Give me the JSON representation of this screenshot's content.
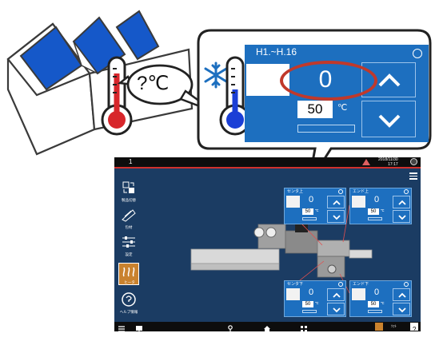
{
  "zoom": {
    "title": "H1.~H.16",
    "current_value": "0",
    "set_value": "50",
    "unit": "℃"
  },
  "thermo_bubble": {
    "text": "?℃"
  },
  "hmi": {
    "screen_no": "1",
    "date": "2018/11/30",
    "time": "17:17",
    "sidebar": [
      {
        "label": "製品切替"
      },
      {
        "label": "包材"
      },
      {
        "label": "設定"
      },
      {
        "label": "ヒータ"
      },
      {
        "label": "ヘルプ情報"
      }
    ],
    "zones": [
      {
        "title": "センタ上",
        "value": "0",
        "set": "50",
        "unit": "℃"
      },
      {
        "title": "エンド上",
        "value": "0",
        "set": "50",
        "unit": "℃"
      },
      {
        "title": "センタ下",
        "value": "0",
        "set": "50",
        "unit": "℃"
      },
      {
        "title": "エンド下",
        "value": "0",
        "set": "50",
        "unit": "℃"
      }
    ],
    "bottom_label": "ｿﾌﾄ"
  },
  "colors": {
    "roof": "#1558c9",
    "panel_blue": "#1d6fbf",
    "hmi_bg": "#1b3c63",
    "heater_accent": "#c9822e",
    "highlight_red": "#c0392b"
  }
}
